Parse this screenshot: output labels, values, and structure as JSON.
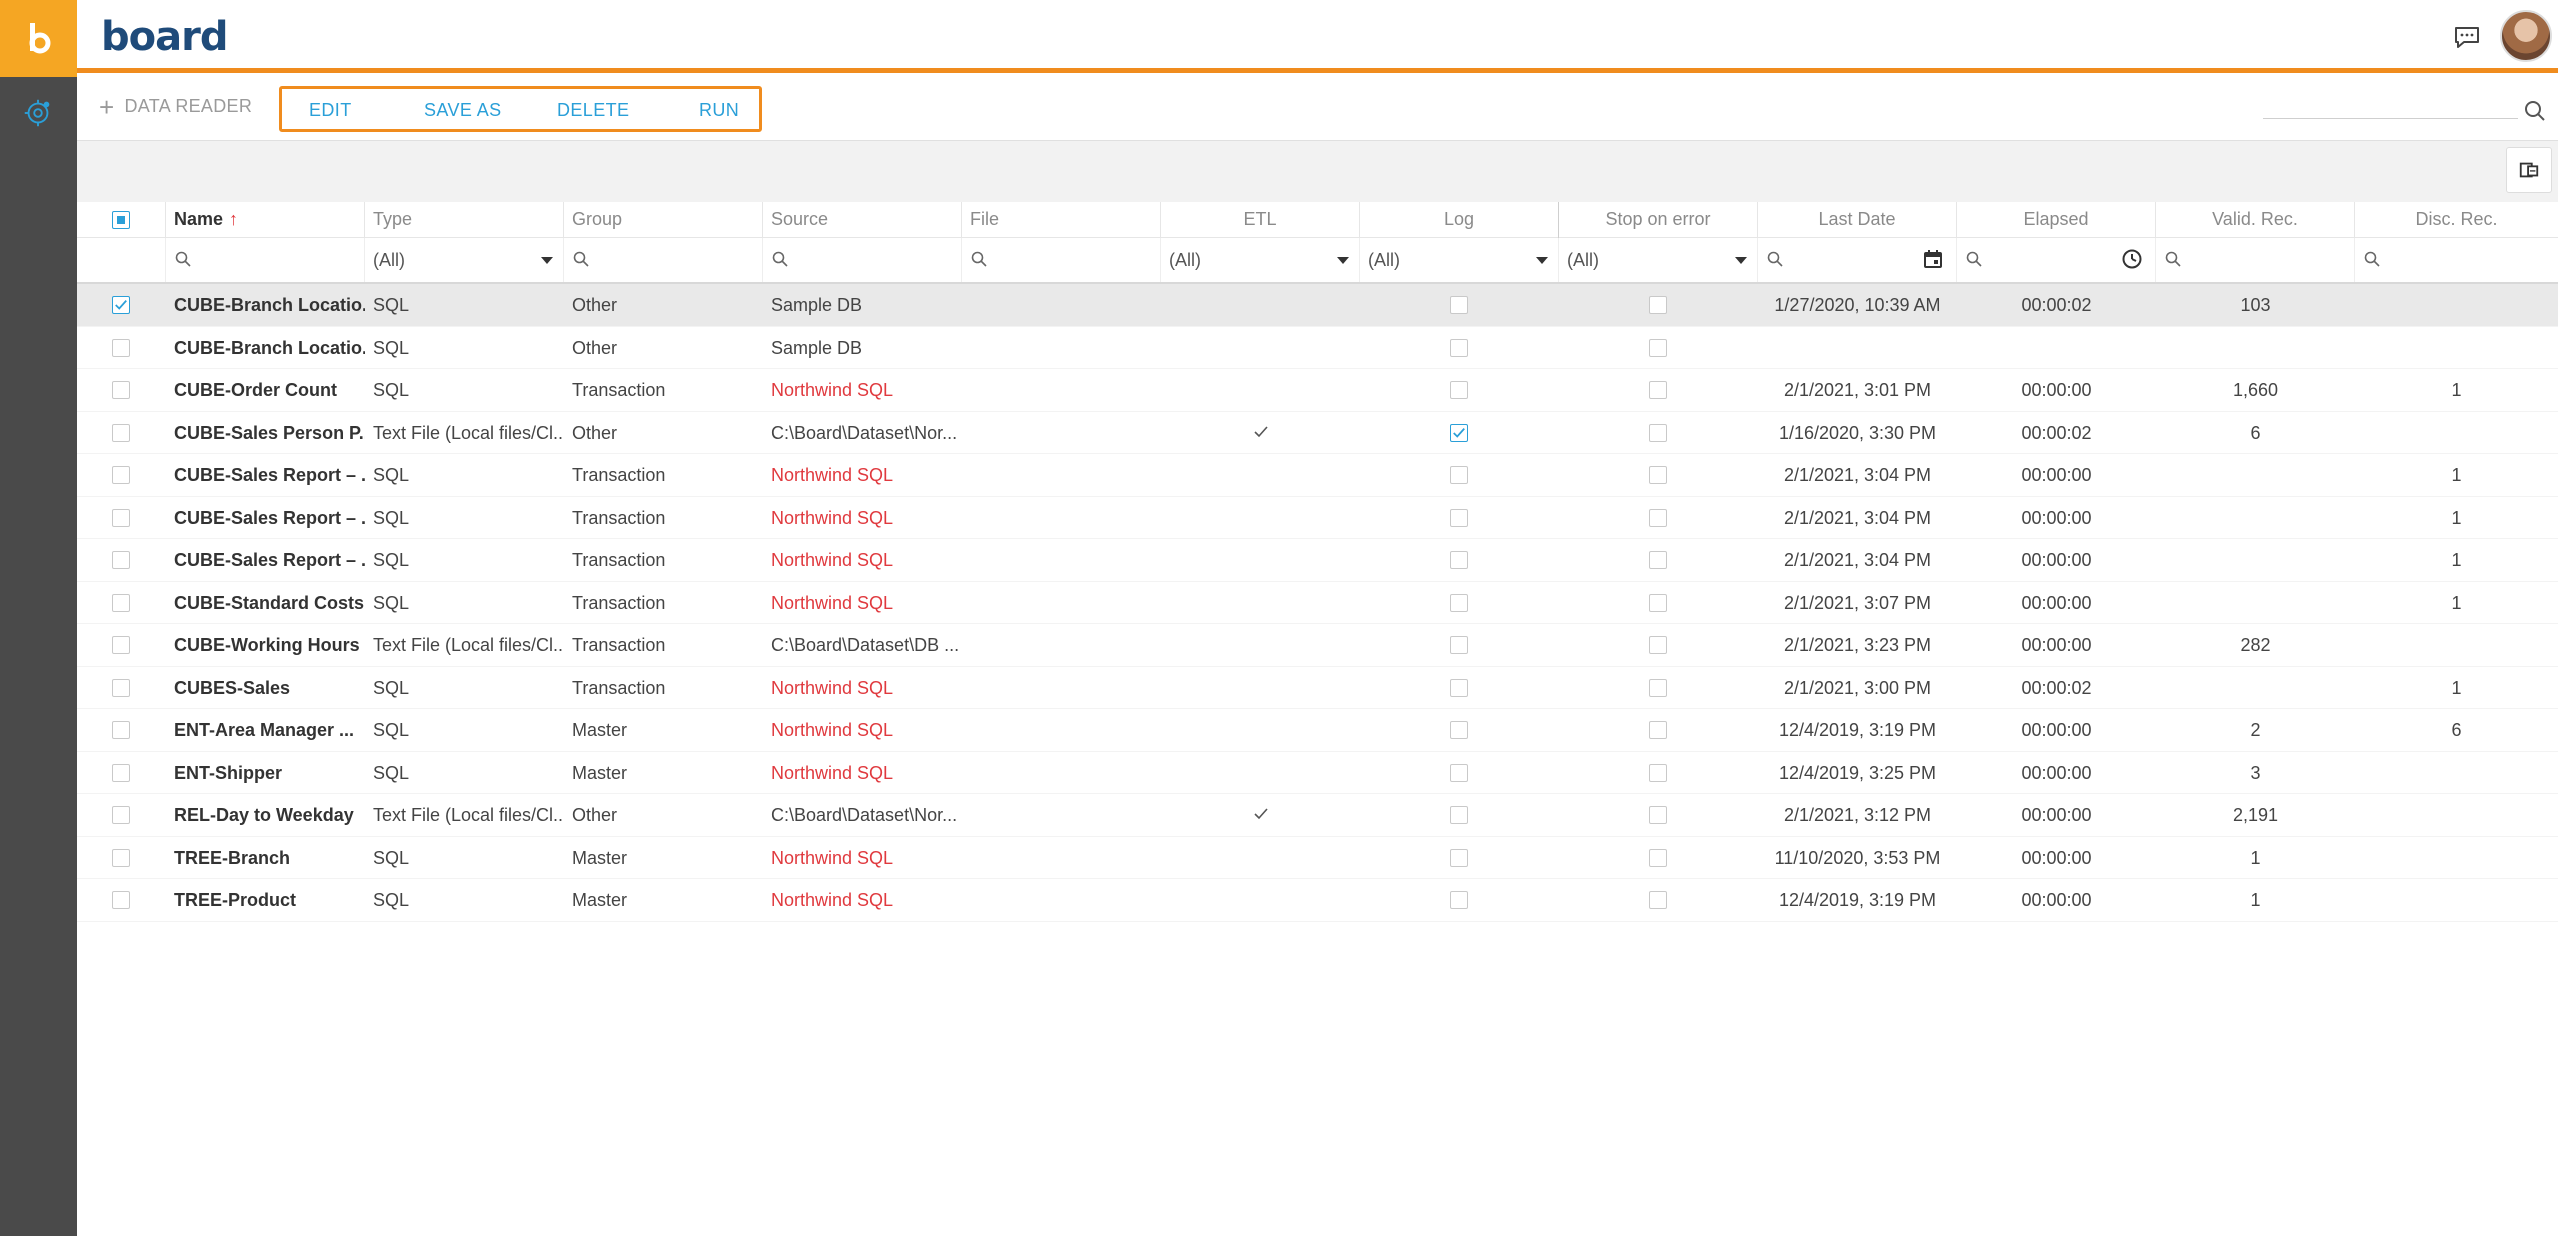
{
  "app": {
    "brand": "board",
    "brand_color": "#1f4b7a",
    "accent_color": "#f08c1e",
    "link_color": "#2a9fd8",
    "error_color": "#e0393e"
  },
  "toolbar": {
    "new_label": "DATA READER",
    "actions": [
      "EDIT",
      "SAVE AS",
      "DELETE",
      "RUN"
    ]
  },
  "filters": {
    "type": "(All)",
    "etl": "(All)",
    "log": "(All)",
    "stop_on_error": "(All)"
  },
  "columns": [
    "Name",
    "Type",
    "Group",
    "Source",
    "File",
    "ETL",
    "Log",
    "Stop on error",
    "Last Date",
    "Elapsed",
    "Valid. Rec.",
    "Disc. Rec."
  ],
  "rows": [
    {
      "name": "CUBE-Branch Locatio...",
      "type": "SQL",
      "group": "Other",
      "source": "Sample DB",
      "source_red": false,
      "etl": false,
      "log": false,
      "last_date": "1/27/2020, 10:39 AM",
      "elapsed": "00:00:02",
      "valid": "103",
      "disc": "",
      "selected": true
    },
    {
      "name": "CUBE-Branch Locatio...",
      "type": "SQL",
      "group": "Other",
      "source": "Sample DB",
      "source_red": false,
      "etl": false,
      "log": false,
      "last_date": "",
      "elapsed": "",
      "valid": "",
      "disc": "",
      "selected": false
    },
    {
      "name": "CUBE-Order Count",
      "type": "SQL",
      "group": "Transaction",
      "source": "Northwind SQL",
      "source_red": true,
      "etl": false,
      "log": false,
      "last_date": "2/1/2021, 3:01 PM",
      "elapsed": "00:00:00",
      "valid": "1,660",
      "disc": "1",
      "selected": false
    },
    {
      "name": "CUBE-Sales Person P...",
      "type": "Text File (Local files/Cl...",
      "group": "Other",
      "source": "C:\\Board\\Dataset\\Nor...",
      "source_red": false,
      "etl": true,
      "log": true,
      "last_date": "1/16/2020, 3:30 PM",
      "elapsed": "00:00:02",
      "valid": "6",
      "disc": "",
      "selected": false
    },
    {
      "name": "CUBE-Sales Report – ...",
      "type": "SQL",
      "group": "Transaction",
      "source": "Northwind SQL",
      "source_red": true,
      "etl": false,
      "log": false,
      "last_date": "2/1/2021, 3:04 PM",
      "elapsed": "00:00:00",
      "valid": "",
      "disc": "1",
      "selected": false
    },
    {
      "name": "CUBE-Sales Report – ...",
      "type": "SQL",
      "group": "Transaction",
      "source": "Northwind SQL",
      "source_red": true,
      "etl": false,
      "log": false,
      "last_date": "2/1/2021, 3:04 PM",
      "elapsed": "00:00:00",
      "valid": "",
      "disc": "1",
      "selected": false
    },
    {
      "name": "CUBE-Sales Report – ...",
      "type": "SQL",
      "group": "Transaction",
      "source": "Northwind SQL",
      "source_red": true,
      "etl": false,
      "log": false,
      "last_date": "2/1/2021, 3:04 PM",
      "elapsed": "00:00:00",
      "valid": "",
      "disc": "1",
      "selected": false
    },
    {
      "name": "CUBE-Standard Costs",
      "type": "SQL",
      "group": "Transaction",
      "source": "Northwind SQL",
      "source_red": true,
      "etl": false,
      "log": false,
      "last_date": "2/1/2021, 3:07 PM",
      "elapsed": "00:00:00",
      "valid": "",
      "disc": "1",
      "selected": false
    },
    {
      "name": "CUBE-Working Hours",
      "type": "Text File (Local files/Cl...",
      "group": "Transaction",
      "source": "C:\\Board\\Dataset\\DB ...",
      "source_red": false,
      "etl": false,
      "log": false,
      "last_date": "2/1/2021, 3:23 PM",
      "elapsed": "00:00:00",
      "valid": "282",
      "disc": "",
      "selected": false
    },
    {
      "name": "CUBES-Sales",
      "type": "SQL",
      "group": "Transaction",
      "source": "Northwind SQL",
      "source_red": true,
      "etl": false,
      "log": false,
      "last_date": "2/1/2021, 3:00 PM",
      "elapsed": "00:00:02",
      "valid": "",
      "disc": "1",
      "selected": false
    },
    {
      "name": "ENT-Area Manager ...",
      "type": "SQL",
      "group": "Master",
      "source": "Northwind SQL",
      "source_red": true,
      "etl": false,
      "log": false,
      "last_date": "12/4/2019, 3:19 PM",
      "elapsed": "00:00:00",
      "valid": "2",
      "disc": "6",
      "selected": false
    },
    {
      "name": "ENT-Shipper",
      "type": "SQL",
      "group": "Master",
      "source": "Northwind SQL",
      "source_red": true,
      "etl": false,
      "log": false,
      "last_date": "12/4/2019, 3:25 PM",
      "elapsed": "00:00:00",
      "valid": "3",
      "disc": "",
      "selected": false
    },
    {
      "name": "REL-Day to Weekday",
      "type": "Text File (Local files/Cl...",
      "group": "Other",
      "source": "C:\\Board\\Dataset\\Nor...",
      "source_red": false,
      "etl": true,
      "log": false,
      "last_date": "2/1/2021, 3:12 PM",
      "elapsed": "00:00:00",
      "valid": "2,191",
      "disc": "",
      "selected": false
    },
    {
      "name": "TREE-Branch",
      "type": "SQL",
      "group": "Master",
      "source": "Northwind SQL",
      "source_red": true,
      "etl": false,
      "log": false,
      "last_date": "11/10/2020, 3:53 PM",
      "elapsed": "00:00:00",
      "valid": "1",
      "disc": "",
      "selected": false
    },
    {
      "name": "TREE-Product",
      "type": "SQL",
      "group": "Master",
      "source": "Northwind SQL",
      "source_red": true,
      "etl": false,
      "log": false,
      "last_date": "12/4/2019, 3:19 PM",
      "elapsed": "00:00:00",
      "valid": "1",
      "disc": "",
      "selected": false
    }
  ]
}
